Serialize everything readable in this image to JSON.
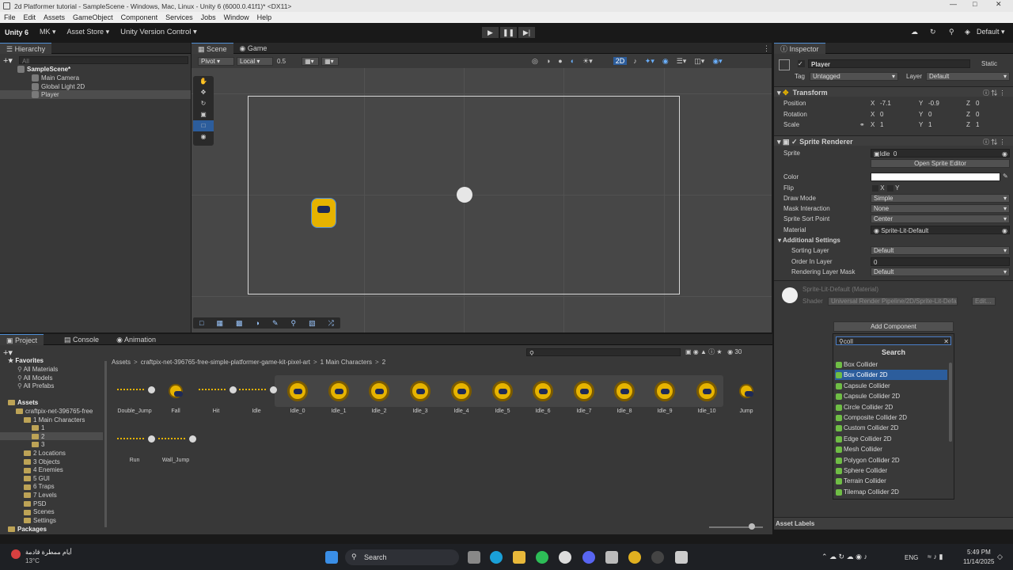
{
  "window": {
    "title": "2d Platformer tutorial - SampleScene - Windows, Mac, Linux - Unity 6 (6000.0.41f1)* <DX11>"
  },
  "menu": [
    "File",
    "Edit",
    "Assets",
    "GameObject",
    "Component",
    "Services",
    "Jobs",
    "Window",
    "Help"
  ],
  "toolbar": {
    "unity": "Unity 6",
    "account": "MK",
    "asset_store": "Asset Store",
    "vcs": "Unity Version Control",
    "layout": "Default"
  },
  "hierarchy": {
    "title": "Hierarchy",
    "search_placeholder": "All",
    "scene": "SampleScene*",
    "items": [
      "Main Camera",
      "Global Light 2D",
      "Player"
    ]
  },
  "scene_tabs": {
    "scene": "Scene",
    "game": "Game",
    "pivot": "Pivot",
    "local": "Local",
    "snap": "0.5",
    "mode2d": "2D"
  },
  "inspector": {
    "title": "Inspector",
    "object": "Player",
    "static": "Static",
    "tag_label": "Tag",
    "tag": "Untagged",
    "layer_label": "Layer",
    "layer": "Default",
    "transform": {
      "title": "Transform",
      "position": "Position",
      "rotation": "Rotation",
      "scale": "Scale",
      "pos": [
        "-7.1",
        "-0.9",
        "0"
      ],
      "rot": [
        "0",
        "0",
        "0"
      ],
      "scl": [
        "1",
        "1",
        "1"
      ],
      "x": "X",
      "y": "Y",
      "z": "Z"
    },
    "sprite_renderer": {
      "title": "Sprite Renderer",
      "sprite_label": "Sprite",
      "sprite": "Idle_0",
      "open_editor": "Open Sprite Editor",
      "color": "Color",
      "flip": "Flip",
      "draw_mode_label": "Draw Mode",
      "draw_mode": "Simple",
      "mask_label": "Mask Interaction",
      "mask": "None",
      "sort_point_label": "Sprite Sort Point",
      "sort_point": "Center",
      "material_label": "Material",
      "material": "Sprite-Lit-Default",
      "additional": "Additional Settings",
      "sorting_layer_label": "Sorting Layer",
      "sorting_layer": "Default",
      "order_label": "Order In Layer",
      "order": "0",
      "rlm_label": "Rendering Layer Mask",
      "rlm": "Default"
    },
    "material_block": {
      "name": "Sprite-Lit-Default (Material)",
      "shader_label": "Shader",
      "shader": "Universal Render Pipeline/2D/Sprite-Lit-Default",
      "edit": "Edit..."
    },
    "add_component": "Add Component",
    "asset_labels": "Asset Labels"
  },
  "popup": {
    "search_value": "coll",
    "header": "Search",
    "items": [
      "Box Collider",
      "Box Collider 2D",
      "Capsule Collider",
      "Capsule Collider 2D",
      "Circle Collider 2D",
      "Composite Collider 2D",
      "Custom Collider 2D",
      "Edge Collider 2D",
      "Mesh Collider",
      "Polygon Collider 2D",
      "Sphere Collider",
      "Terrain Collider",
      "Tilemap Collider 2D"
    ],
    "selected_index": 1
  },
  "bottom_tabs": {
    "project": "Project",
    "console": "Console",
    "animation": "Animation",
    "count": "30"
  },
  "project_tree": {
    "favorites": "Favorites",
    "fav_items": [
      "All Materials",
      "All Models",
      "All Prefabs"
    ],
    "assets": "Assets",
    "root": "craftpix-net-396765-free",
    "main": "1 Main Characters",
    "sub": [
      "1",
      "2",
      "3"
    ],
    "folders": [
      "2 Locations",
      "3 Objects",
      "4 Enemies",
      "5 GUI",
      "6 Traps",
      "7 Levels",
      "PSD",
      "Scenes",
      "Settings"
    ],
    "packages": "Packages"
  },
  "breadcrumb": [
    "Assets",
    "craftpix-net-396765-free-simple-platformer-game-kit-pixel-art",
    "1 Main Characters",
    "2"
  ],
  "assets_row1": [
    "Double_Jump",
    "Fall",
    "Hit",
    "Idle",
    "Idle_0",
    "Idle_1",
    "Idle_2",
    "Idle_3",
    "Idle_4",
    "Idle_5",
    "Idle_6",
    "Idle_7",
    "Idle_8",
    "Idle_9",
    "Idle_10",
    "Jump"
  ],
  "assets_row2": [
    "Run",
    "Wall_Jump"
  ],
  "taskbar": {
    "weather_text": "أيام ممطرة قادمة",
    "temp": "13°C",
    "search": "Search",
    "lang": "ENG",
    "time": "5:49 PM",
    "date": "11/14/2025"
  }
}
